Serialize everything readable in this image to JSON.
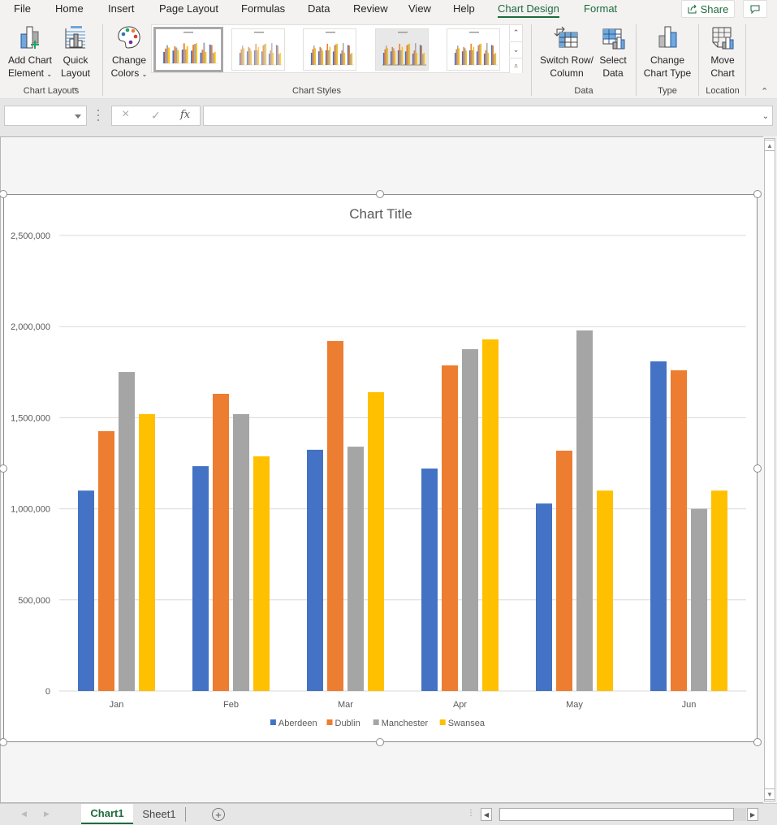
{
  "menu": {
    "tabs": [
      "File",
      "Home",
      "Insert",
      "Page Layout",
      "Formulas",
      "Data",
      "Review",
      "View",
      "Help",
      "Chart Design",
      "Format"
    ],
    "active_tab": "Chart Design",
    "share_label": "Share"
  },
  "ribbon": {
    "add_chart_element": [
      "Add Chart",
      "Element"
    ],
    "quick_layout": [
      "Quick",
      "Layout"
    ],
    "change_colors": [
      "Change",
      "Colors"
    ],
    "switch_row_column": [
      "Switch Row/",
      "Column"
    ],
    "select_data": [
      "Select",
      "Data"
    ],
    "change_chart_type": [
      "Change",
      "Chart Type"
    ],
    "move_chart": [
      "Move",
      "Chart"
    ],
    "groups": {
      "chart_layouts": "Chart Layouts",
      "chart_styles": "Chart Styles",
      "data": "Data",
      "type": "Type",
      "location": "Location"
    },
    "chart_style_thumbnails": 5,
    "selected_style_index": 0
  },
  "formula_bar": {
    "name_box_value": "",
    "formula_value": "",
    "cancel_icon": "×",
    "enter_icon": "✓",
    "fx_label": "fx"
  },
  "sheets": {
    "tabs": [
      "Chart1",
      "Sheet1"
    ],
    "active": "Chart1"
  },
  "colors": {
    "accent": "#1e6b3d",
    "aberdeen": "#4472c4",
    "dublin": "#ed7d31",
    "manchester": "#a5a5a5",
    "swansea": "#ffc000"
  },
  "chart_data": {
    "type": "bar",
    "title": "Chart Title",
    "xlabel": "",
    "ylabel": "",
    "categories": [
      "Jan",
      "Feb",
      "Mar",
      "Apr",
      "May",
      "Jun"
    ],
    "ylim": [
      0,
      2500000
    ],
    "yticks": [
      0,
      500000,
      1000000,
      1500000,
      2000000,
      2500000
    ],
    "ytick_labels": [
      "0",
      "500,000",
      "1,000,000",
      "1,500,000",
      "2,000,000",
      "2,500,000"
    ],
    "grid": true,
    "legend_position": "bottom",
    "series": [
      {
        "name": "Aberdeen",
        "color": "#4472c4",
        "values": [
          1100000,
          1234000,
          1324000,
          1221000,
          1029000,
          1809000
        ]
      },
      {
        "name": "Dublin",
        "color": "#ed7d31",
        "values": [
          1426000,
          1631000,
          1921000,
          1787000,
          1319000,
          1760000
        ]
      },
      {
        "name": "Manchester",
        "color": "#a5a5a5",
        "values": [
          1751000,
          1520000,
          1341000,
          1876000,
          1979000,
          1000000
        ]
      },
      {
        "name": "Swansea",
        "color": "#ffc000",
        "values": [
          1520000,
          1288000,
          1640000,
          1930000,
          1100000,
          1100000
        ]
      }
    ]
  }
}
